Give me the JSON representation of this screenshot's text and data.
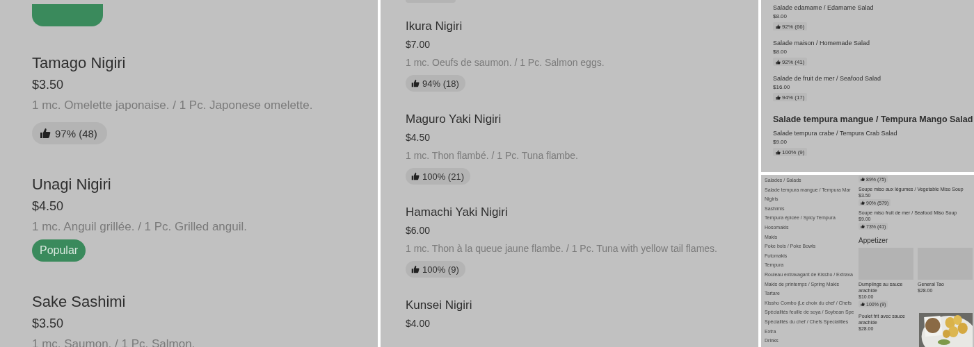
{
  "panels": [
    {
      "kind": "large",
      "clipped_top": {
        "kind": "popular"
      },
      "rows": [
        {
          "kind": "item",
          "name": "Tamago Nigiri",
          "price": "$3.50",
          "description": "1 mc. Omelette japonaise. / 1 Pc. Japonese omelette.",
          "rating": "97% (48)"
        },
        {
          "kind": "item",
          "name": "Unagi Nigiri",
          "price": "$4.50",
          "description": "1 mc. Anguil grillée. / 1 Pc. Grilled anguil.",
          "badge": "Popular"
        },
        {
          "kind": "item",
          "name": "Sake Sashimi",
          "price": "$3.50",
          "description": "1 mc. Saumon. / 1 Pc. Salmon."
        }
      ]
    },
    {
      "kind": "medium",
      "clipped_top": {
        "kind": "rating"
      },
      "rows": [
        {
          "kind": "item",
          "name": "Ikura Nigiri",
          "price": "$7.00",
          "description": "1 mc. Oeufs de saumon. / 1 Pc. Salmon eggs.",
          "rating": "94% (18)"
        },
        {
          "kind": "item",
          "name": "Maguro Yaki Nigiri",
          "price": "$4.50",
          "description": "1 mc. Thon flambé. / 1 Pc. Tuna flambe.",
          "rating": "100% (21)"
        },
        {
          "kind": "item",
          "name": "Hamachi Yaki Nigiri",
          "price": "$6.00",
          "description": "1 mc. Thon à la queue jaune flambe. / 1 Pc. Tuna with yellow tail flames.",
          "rating": "100% (9)"
        },
        {
          "kind": "item",
          "name": "Kunsei Nigiri",
          "price": "$4.00"
        }
      ]
    },
    {
      "kind": "small",
      "rows": [
        {
          "kind": "item",
          "name": "Salade edamame / Edamame Salad",
          "price": "$8.00",
          "rating": "92% (66)"
        },
        {
          "kind": "item",
          "name": "Salade maison / Homemade Salad",
          "price": "$8.00",
          "rating": "92% (41)"
        },
        {
          "kind": "item",
          "name": "Salade de fruit de mer / Seafood Salad",
          "price": "$16.00",
          "rating": "94% (17)"
        },
        {
          "kind": "heading",
          "name": "Salade tempura mangue / Tempura Mango Salad"
        },
        {
          "kind": "item",
          "name": "Salade tempura crabe / Tempura Crab Salad",
          "price": "$9.00",
          "rating": "100% (9)"
        }
      ]
    },
    {
      "kind": "tiny",
      "categories": [
        "Salades / Salads",
        "Salade tempura mangue / Tempura Mar",
        "Nigiris",
        "Sashimis",
        "Tempura épicée / Spicy Tempura",
        "Hosomakis",
        "Makis",
        "Poke bols / Poke Bowls",
        "Futomakis",
        "Tempura",
        "Rouleau extravagant de Kissho / Extrava",
        "Makis de printemps / Spring Makis",
        "Tartare",
        "Kissho Combo (Le choix du chef / Chefs",
        "Spécialités feuille de soya / Soybean Spe",
        "Spécialités du chef / Chefs Specialities",
        "Extra",
        "Drinks"
      ],
      "rows": [
        {
          "kind": "item",
          "rating": "89% (75)"
        },
        {
          "kind": "item",
          "name": "Soupe miso aux légumes / Vegetable Miso Soup",
          "price": "$3.50",
          "rating": "90% (579)"
        },
        {
          "kind": "item",
          "name": "Soupe miso fruit de mer / Seafood Miso Soup",
          "price": "$9.00",
          "rating": "73% (41)"
        },
        {
          "kind": "heading",
          "name": "Appetizer"
        },
        {
          "kind": "cards",
          "cards": [
            {
              "kind": "placeholder",
              "name": "Dumplings au sauce arachide",
              "price": "$10.00",
              "rating": "100% (9)"
            },
            {
              "kind": "placeholder",
              "name": "General Tao",
              "price": "$28.00"
            },
            {
              "kind": "text",
              "name": "Poulet frit avec sauce arachide",
              "price": "$28.00"
            },
            {
              "kind": "picture"
            }
          ]
        }
      ]
    }
  ]
}
